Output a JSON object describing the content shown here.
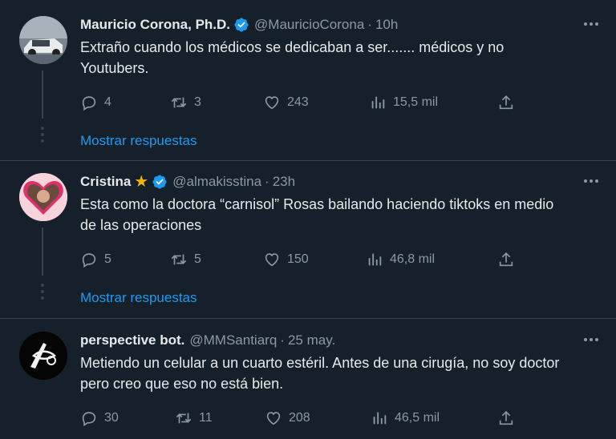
{
  "tweets": [
    {
      "name": "Mauricio Corona, Ph.D.",
      "handle": "@MauricioCorona",
      "separator": "·",
      "time": "10h",
      "verified": true,
      "star": false,
      "text": "Extraño cuando los médicos se dedicaban a ser....... médicos y no Youtubers.",
      "replies": "4",
      "retweets": "3",
      "likes": "243",
      "views": "15,5 mil",
      "show_replies": "Mostrar respuestas"
    },
    {
      "name": "Cristina",
      "handle": "@almakisstina",
      "separator": "·",
      "time": "23h",
      "verified": true,
      "star": true,
      "text": "Esta como la doctora “carnisol” Rosas bailando haciendo tiktoks en medio de las operaciones",
      "replies": "5",
      "retweets": "5",
      "likes": "150",
      "views": "46,8 mil",
      "show_replies": "Mostrar respuestas"
    },
    {
      "name": "perspective bot.",
      "handle": "@MMSantiarq",
      "separator": "·",
      "time": "25 may.",
      "verified": false,
      "star": false,
      "text": "Metiendo un celular a un cuarto estéril. Antes de una cirugía, no soy doctor pero creo que eso no está bien.",
      "replies": "30",
      "retweets": "11",
      "likes": "208",
      "views": "46,5 mil"
    }
  ],
  "colors": {
    "background": "#15202b",
    "accent": "#1d9bf0",
    "muted": "#8b98a5",
    "star": "#f4b400"
  },
  "icons": [
    "reply-icon",
    "retweet-icon",
    "like-icon",
    "views-icon",
    "share-icon",
    "verified-badge-icon",
    "more-options-icon",
    "star-icon"
  ]
}
